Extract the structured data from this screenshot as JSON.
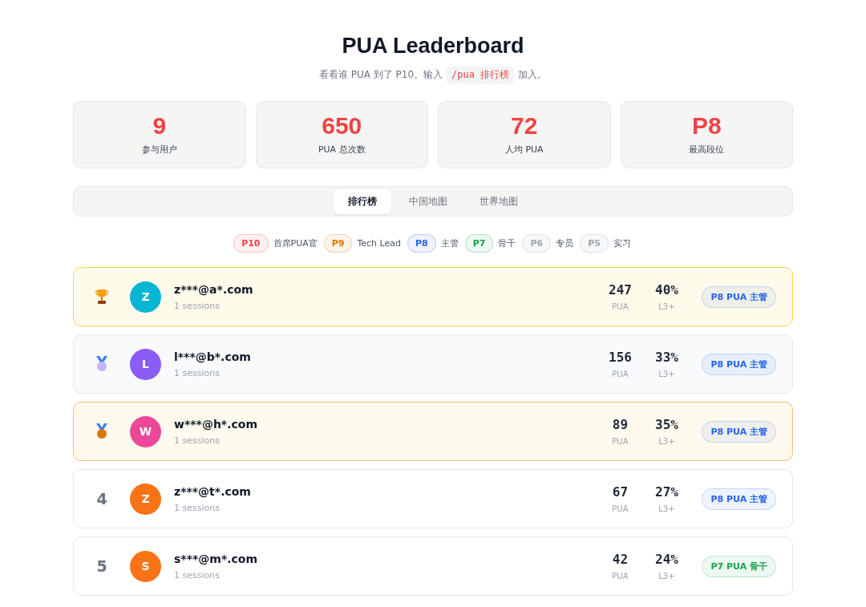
{
  "header": {
    "title": "PUA Leaderboard",
    "subtitle_before": "看看谁 PUA 到了 P10。输入",
    "command": "/pua 排行榜",
    "subtitle_after": "加入。"
  },
  "stats": [
    {
      "value": "9",
      "label": "参与用户"
    },
    {
      "value": "650",
      "label": "PUA 总次数"
    },
    {
      "value": "72",
      "label": "人均 PUA"
    },
    {
      "value": "P8",
      "label": "最高段位"
    }
  ],
  "tabs": [
    {
      "label": "排行榜",
      "selected": true
    },
    {
      "label": "中国地图",
      "selected": false
    },
    {
      "label": "世界地图",
      "selected": false
    }
  ],
  "legend": [
    {
      "tier": "P10",
      "name": "首席PUA官",
      "color": "#ef4444"
    },
    {
      "tier": "P9",
      "name": "Tech Lead",
      "color": "#d97706"
    },
    {
      "tier": "P8",
      "name": "主管",
      "color": "#2563eb"
    },
    {
      "tier": "P7",
      "name": "骨干",
      "color": "#16a34a"
    },
    {
      "tier": "P6",
      "name": "专员",
      "color": "#9ca3af"
    },
    {
      "tier": "P5",
      "name": "实习",
      "color": "#9ca3af"
    }
  ],
  "rows": [
    {
      "kind": "gold",
      "avatar": {
        "letter": "Z",
        "color": "#06b6d4"
      },
      "email": "z***@a*.com",
      "sessions": "1 sessions",
      "pua": "247",
      "pua_label": "PUA",
      "l3": "40%",
      "l3_label": "L3+",
      "badge": {
        "label": "P8 PUA 主管",
        "color": "#2563eb"
      }
    },
    {
      "kind": "silver",
      "avatar": {
        "letter": "L",
        "color": "#8b5cf6"
      },
      "email": "l***@b*.com",
      "sessions": "1 sessions",
      "pua": "156",
      "pua_label": "PUA",
      "l3": "33%",
      "l3_label": "L3+",
      "badge": {
        "label": "P8 PUA 主管",
        "color": "#2563eb"
      }
    },
    {
      "kind": "bronze",
      "avatar": {
        "letter": "W",
        "color": "#ec4899"
      },
      "email": "w***@h*.com",
      "sessions": "1 sessions",
      "pua": "89",
      "pua_label": "PUA",
      "l3": "35%",
      "l3_label": "L3+",
      "badge": {
        "label": "P8 PUA 主管",
        "color": "#2563eb"
      }
    },
    {
      "kind": "number",
      "rank": "4",
      "avatar": {
        "letter": "Z",
        "color": "#f97316"
      },
      "email": "z***@t*.com",
      "sessions": "1 sessions",
      "pua": "67",
      "pua_label": "PUA",
      "l3": "27%",
      "l3_label": "L3+",
      "badge": {
        "label": "P8 PUA 主管",
        "color": "#2563eb"
      }
    },
    {
      "kind": "number",
      "rank": "5",
      "avatar": {
        "letter": "S",
        "color": "#f97316"
      },
      "email": "s***@m*.com",
      "sessions": "1 sessions",
      "pua": "42",
      "pua_label": "PUA",
      "l3": "24%",
      "l3_label": "L3+",
      "badge": {
        "label": "P7 PUA 骨干",
        "color": "#16a34a"
      }
    }
  ]
}
